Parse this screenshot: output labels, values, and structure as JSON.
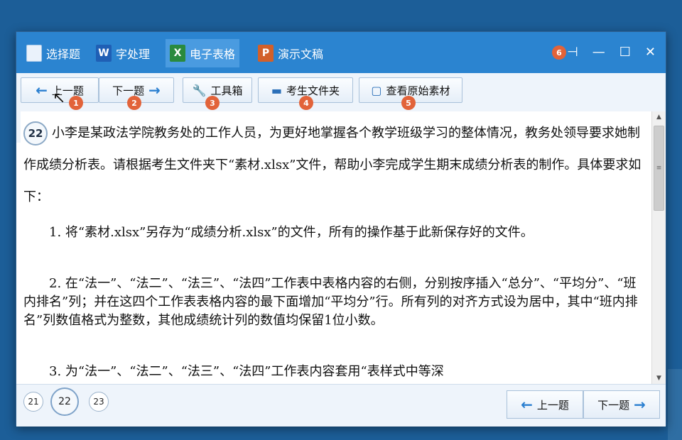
{
  "titlebar": {
    "tabs": [
      {
        "label": "选择题",
        "icon": "document-icon"
      },
      {
        "label": "字处理",
        "icon": "word-icon",
        "glyph": "W"
      },
      {
        "label": "电子表格",
        "icon": "excel-icon",
        "glyph": "X"
      },
      {
        "label": "演示文稿",
        "icon": "powerpoint-icon",
        "glyph": "P"
      }
    ],
    "badge": "6",
    "controls": {
      "pin": "⊣",
      "minimize": "—",
      "maximize": "☐",
      "close": "✕"
    }
  },
  "toolbar": {
    "prev": "上一题",
    "next": "下一题",
    "toolbox": "工具箱",
    "folder": "考生文件夹",
    "view_source": "查看原始素材",
    "badges": [
      "1",
      "2",
      "3",
      "4",
      "5"
    ]
  },
  "question": {
    "number": "22",
    "intro": "小李是某政法学院教务处的工作人员，为更好地掌握各个教学班级学习的整体情况，教务处领导要求她制作成绩分析表。请根据考生文件夹下“素材.xlsx”文件，帮助小李完成学生期末成绩分析表的制作。具体要求如下：",
    "items": [
      "1. 将“素材.xlsx”另存为“成绩分析.xlsx”的文件，所有的操作基于此新保存好的文件。",
      "2. 在“法一”、“法二”、“法三”、“法四”工作表中表格内容的右侧，分别按序插入“总分”、“平均分”、“班内排名”列；并在这四个工作表表格内容的最下面增加“平均分”行。所有列的对齐方式设为居中，其中“班内排名”列数值格式为整数，其他成绩统计列的数值均保留1位小数。",
      "3. 为“法一”、“法二”、“法三”、“法四”工作表内容套用“表样式中等深"
    ]
  },
  "footer": {
    "question_nav": [
      "21",
      "22",
      "23"
    ],
    "prev": "上一题",
    "next": "下一题"
  },
  "colors": {
    "titlebar": "#2b84d0",
    "badge": "#e2633a",
    "arrow": "#2a7fd0"
  }
}
